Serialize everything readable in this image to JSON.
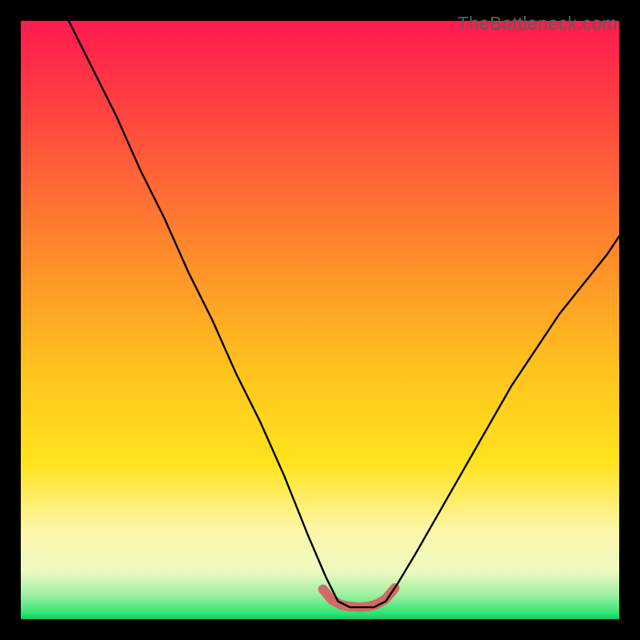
{
  "watermark": {
    "text": "TheBottleneck.com"
  },
  "colors": {
    "red_top": "#ff1a4f",
    "red_mid": "#ff3a43",
    "orange": "#ff8e2a",
    "yellow1": "#ffc21e",
    "yellow2": "#ffe41e",
    "pale": "#fdf6a8",
    "pale2": "#eef9c2",
    "green_l": "#9cf0a0",
    "green": "#2fe574",
    "green_d": "#0fc95e",
    "curve": "#000000",
    "base_marker": "#d16a65"
  },
  "chart_data": {
    "type": "line",
    "title": "",
    "xlabel": "",
    "ylabel": "",
    "xlim": [
      0,
      100
    ],
    "ylim": [
      0,
      100
    ],
    "note": "Axes are implicit (no tick labels shown). y=0 is bottom (green/good), y=100 is top (red/bad). x spans the horizontal extent of the plot. Values are read from the rendered curve; the valley floor near x≈53–61 is the optimal region highlighted by the pink marker.",
    "series": [
      {
        "name": "bottleneck-curve",
        "x": [
          8,
          12,
          16,
          20,
          24,
          28,
          32,
          36,
          40,
          44,
          48,
          51,
          53,
          55,
          57,
          59,
          61,
          63,
          66,
          70,
          74,
          78,
          82,
          86,
          90,
          94,
          98,
          100
        ],
        "y": [
          100,
          92,
          84,
          75,
          67,
          58,
          50,
          41,
          33,
          24,
          14,
          7,
          3,
          2,
          2,
          2,
          3,
          6,
          11,
          18,
          25,
          32,
          39,
          45,
          51,
          56,
          61,
          64
        ]
      }
    ],
    "valley_marker": {
      "description": "short pink/coral segment tracing the bottom of the valley",
      "x": [
        50.5,
        52,
        53.5,
        55,
        56.5,
        58,
        59.5,
        61,
        62.5
      ],
      "y": [
        5.0,
        3.2,
        2.4,
        2.1,
        2.0,
        2.1,
        2.5,
        3.4,
        5.2
      ]
    }
  }
}
